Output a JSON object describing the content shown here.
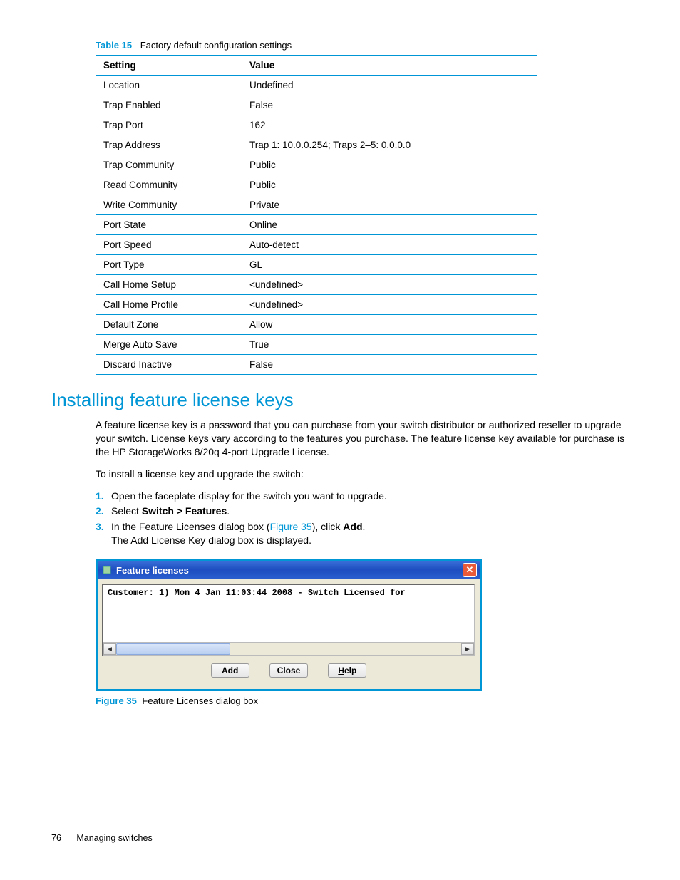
{
  "table_caption": {
    "label": "Table 15",
    "title": "Factory default configuration settings"
  },
  "chart_data": {
    "type": "table",
    "columns": [
      "Setting",
      "Value"
    ],
    "rows": [
      [
        "Location",
        "Undefined"
      ],
      [
        "Trap Enabled",
        "False"
      ],
      [
        "Trap Port",
        "162"
      ],
      [
        "Trap Address",
        "Trap 1: 10.0.0.254; Traps 2–5: 0.0.0.0"
      ],
      [
        "Trap Community",
        "Public"
      ],
      [
        "Read Community",
        "Public"
      ],
      [
        "Write Community",
        "Private"
      ],
      [
        "Port State",
        "Online"
      ],
      [
        "Port Speed",
        "Auto-detect"
      ],
      [
        "Port Type",
        "GL"
      ],
      [
        "Call Home Setup",
        "<undefined>"
      ],
      [
        "Call Home Profile",
        "<undefined>"
      ],
      [
        "Default Zone",
        "Allow"
      ],
      [
        "Merge Auto Save",
        "True"
      ],
      [
        "Discard Inactive",
        "False"
      ]
    ]
  },
  "section_heading": "Installing feature license keys",
  "para1": "A feature license key is a password that you can purchase from your switch distributor or authorized reseller to upgrade your switch. License keys vary according to the features you purchase. The feature license key available for purchase is the HP StorageWorks 8/20q 4-port Upgrade License.",
  "para2": "To install a license key and upgrade the switch:",
  "steps": {
    "s1": {
      "n": "1.",
      "text": "Open the faceplate display for the switch you want to upgrade."
    },
    "s2": {
      "n": "2.",
      "pre": "Select ",
      "b": "Switch > Features",
      "post": "."
    },
    "s3": {
      "n": "3.",
      "pre": "In the Feature Licenses dialog box (",
      "link": "Figure 35",
      "mid": "), click ",
      "b": "Add",
      "post": ".",
      "line2": "The Add License Key dialog box is displayed."
    }
  },
  "dialog": {
    "title": "Feature licenses",
    "close_glyph": "✕",
    "list_line": "Customer: 1) Mon 4 Jan 11:03:44 2008 - Switch Licensed for",
    "scroll_left": "◄",
    "scroll_right": "►",
    "btn_add": "Add",
    "btn_close": "Close",
    "btn_help_u": "H",
    "btn_help_rest": "elp"
  },
  "figure_caption": {
    "label": "Figure 35",
    "title": "Feature Licenses dialog box"
  },
  "footer": {
    "page": "76",
    "section": "Managing switches"
  }
}
